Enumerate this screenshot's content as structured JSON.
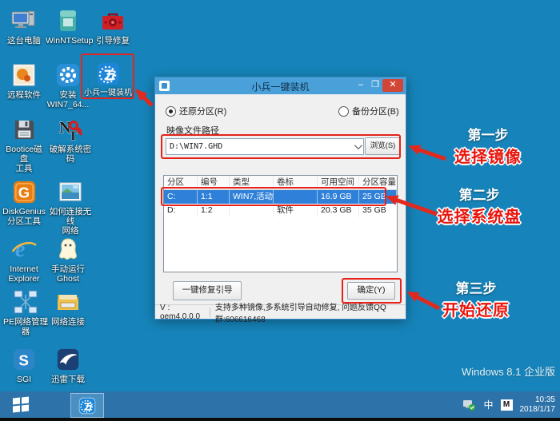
{
  "colors": {
    "desktop_bg": "#1684ba",
    "taskbar_bg": "#2d73aa",
    "titlebar_bg": "#4aa0d8",
    "selection_blue": "#2e80d8",
    "annotation_red": "#e5231b",
    "close_red": "#d24637"
  },
  "desktop": {
    "icons": [
      {
        "label": "这台电脑"
      },
      {
        "label": "WinNTSetup"
      },
      {
        "label": "引导修复"
      },
      {
        "label": "远程软件"
      },
      {
        "label": "安装\nWIN7_64..."
      },
      {
        "label": "小兵一键装机"
      },
      {
        "label": "Bootice磁盘\n工具"
      },
      {
        "label": "破解系统密码"
      },
      {
        "label": "DiskGenius\n分区工具"
      },
      {
        "label": "如何连接无线\n网络"
      },
      {
        "label": "Internet\nExplorer"
      },
      {
        "label": "手动运行\nGhost"
      },
      {
        "label": "PE网络管理器"
      },
      {
        "label": "网络连接"
      },
      {
        "label": "SGI"
      },
      {
        "label": "迅雷下载"
      }
    ],
    "watermark": "Windows 8.1 企业版"
  },
  "dialog": {
    "title": "小兵一键装机",
    "controls": {
      "minimize": "–",
      "maximize": "❒",
      "close": "✕"
    },
    "radio_restore": "还原分区(R)",
    "radio_backup": "备份分区(B)",
    "path_label": "映像文件路径",
    "path_value": "D:\\WIN7.GHD",
    "browse_button": "浏览(S)",
    "table": {
      "headers": [
        "分区",
        "编号",
        "类型",
        "卷标",
        "可用空间",
        "分区容量"
      ],
      "rows": [
        {
          "cells": [
            "C:",
            "1:1",
            "WIN7,活动",
            "",
            "16.9 GB",
            "25 GB"
          ],
          "selected": true
        },
        {
          "cells": [
            "D:",
            "1:2",
            "",
            "软件",
            "20.3 GB",
            "35 GB"
          ],
          "selected": false
        }
      ]
    },
    "repair_button": "一键修复引导",
    "ok_button": "确定(Y)",
    "version": "V : oem4.0.0.0",
    "status": "支持多种镜像,多系统引导自动修复, 问题反馈QQ群:606616468"
  },
  "annotations": {
    "steps": [
      {
        "step": "第一步",
        "action": "选择镜像"
      },
      {
        "step": "第二步",
        "action": "选择系统盘"
      },
      {
        "step": "第三步",
        "action": "开始还原"
      }
    ]
  },
  "taskbar": {
    "ime_lang": "中",
    "ime_mode": "M",
    "time": "10:35",
    "date": "2018/1/17"
  }
}
